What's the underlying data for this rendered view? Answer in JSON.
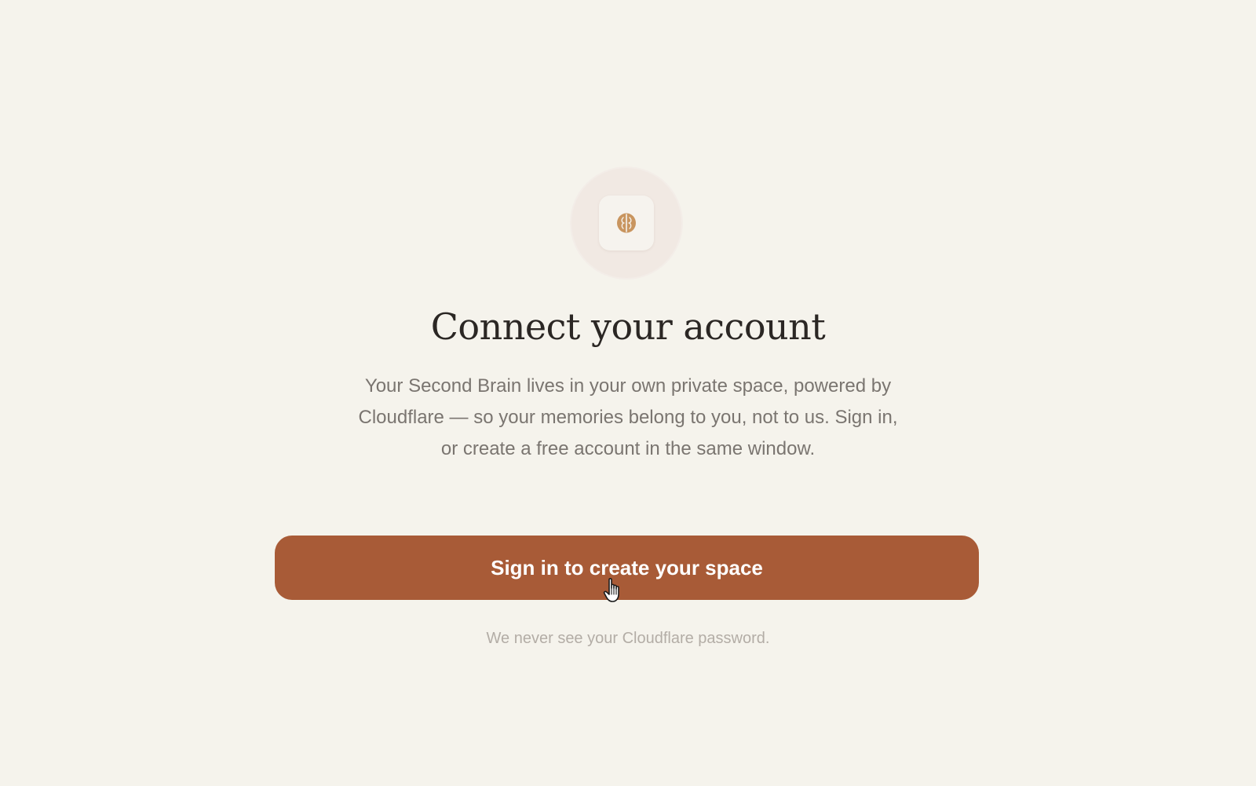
{
  "logo": {
    "icon": "brain-icon",
    "accent_color": "#c9955f"
  },
  "heading": {
    "title": "Connect your account"
  },
  "description": {
    "text": "Your Second Brain lives in your own private space, powered by Cloudflare — so your memories belong to you, not to us. Sign in, or create a free account in the same window."
  },
  "primary_action": {
    "label": "Sign in to create your space",
    "background_color": "#a85b37",
    "text_color": "#ffffff"
  },
  "footnote": {
    "text": "We never see your Cloudflare password."
  },
  "theme": {
    "background": "#f5f3ec",
    "title_color": "#2b2724",
    "body_text_color": "#7a7570",
    "muted_text_color": "#b3ada6"
  }
}
